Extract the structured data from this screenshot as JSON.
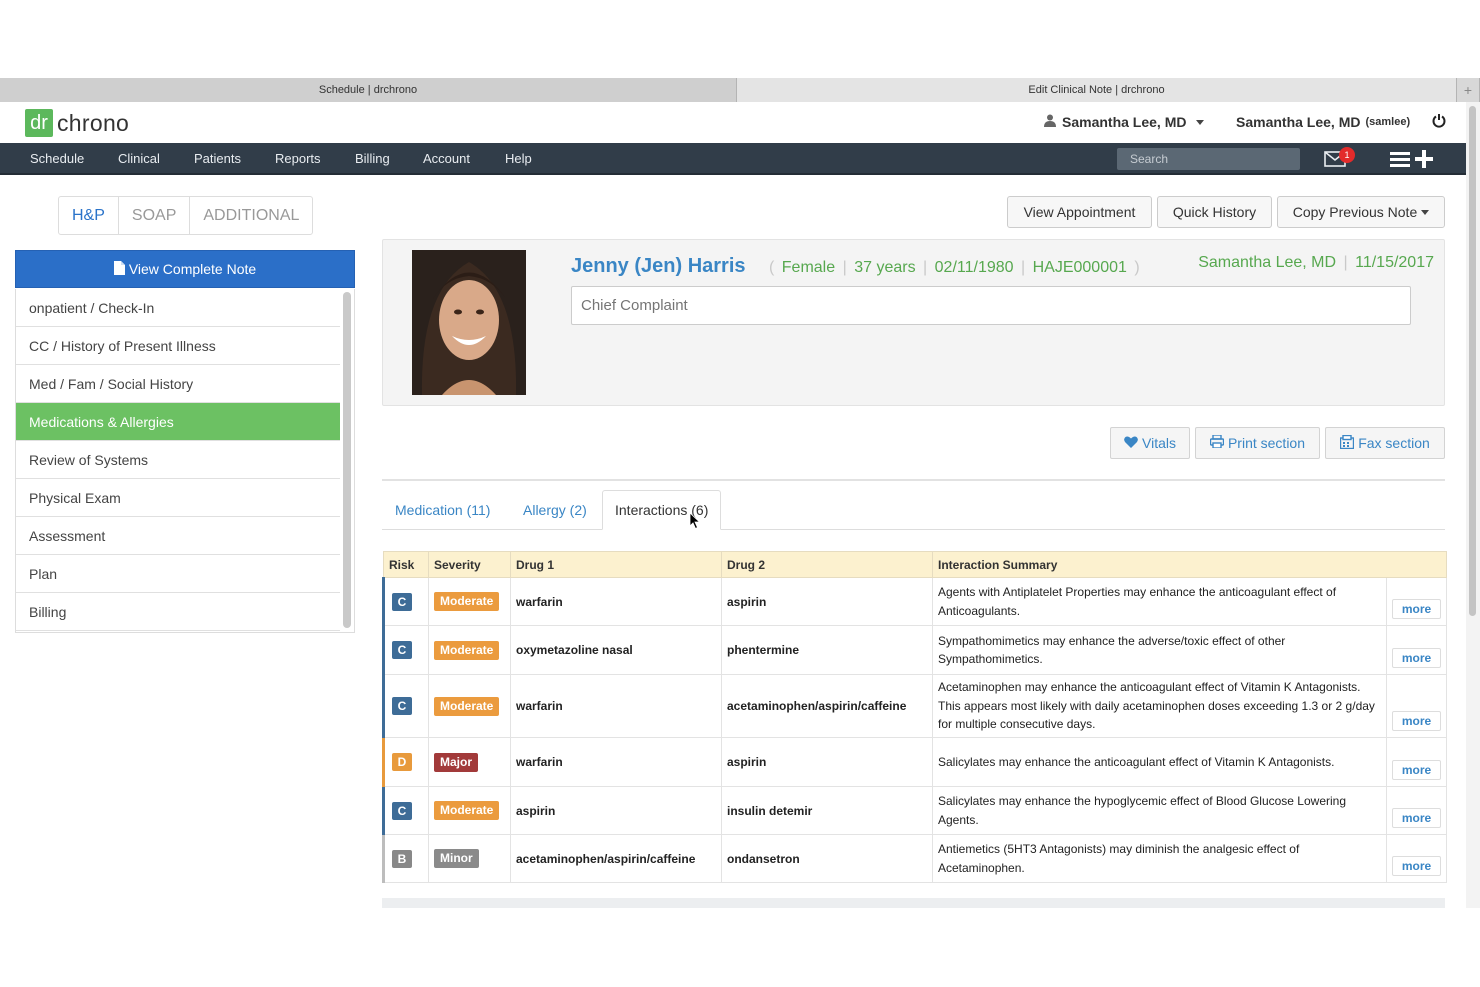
{
  "browser_tabs": [
    {
      "label": "Schedule | drchrono"
    },
    {
      "label": "Edit Clinical Note | drchrono"
    }
  ],
  "new_tab_label": "+",
  "logo": {
    "dr": "dr",
    "chrono": "chrono",
    "brand_color": "#5cb85c"
  },
  "user_menu": {
    "label": "Samantha Lee, MD"
  },
  "user_right": {
    "name": "Samantha Lee, MD",
    "username": "(samlee)"
  },
  "nav": {
    "items": [
      "Schedule",
      "Clinical",
      "Patients",
      "Reports",
      "Billing",
      "Account",
      "Help"
    ],
    "search_placeholder": "Search",
    "mail_badge": "1"
  },
  "note_tabs": [
    "H&P",
    "SOAP",
    "ADDITIONAL"
  ],
  "view_complete_note": "View Complete Note",
  "sections": [
    "onpatient / Check-In",
    "CC / History of Present Illness",
    "Med / Fam / Social History",
    "Medications & Allergies",
    "Review of Systems",
    "Physical Exam",
    "Assessment",
    "Plan",
    "Billing"
  ],
  "active_section": "Medications & Allergies",
  "top_buttons": {
    "view_appointment": "View Appointment",
    "quick_history": "Quick History",
    "copy_previous_note": "Copy Previous Note"
  },
  "patient": {
    "name": "Jenny (Jen) Harris",
    "open_paren": "(",
    "sex": "Female",
    "age": "37 years",
    "dob": "02/11/1980",
    "chart_id": "HAJE000001",
    "close_paren": ")",
    "sep": "|",
    "provider": "Samantha Lee, MD",
    "date": "11/15/2017",
    "chief_complaint_placeholder": "Chief Complaint"
  },
  "section_buttons": {
    "vitals": "Vitals",
    "print": "Print section",
    "fax": "Fax section"
  },
  "med_tabs": [
    "Medication (11)",
    "Allergy (2)",
    "Interactions (6)"
  ],
  "active_med_tab": "Interactions (6)",
  "table": {
    "headers": [
      "Risk",
      "Severity",
      "Drug 1",
      "Drug 2",
      "Interaction Summary"
    ],
    "more_label": "more",
    "rows": [
      {
        "risk": "C",
        "severity": "Moderate",
        "drug1": "warfarin",
        "drug2": "aspirin",
        "summary": "Agents with Antiplatelet Properties may enhance the anticoagulant effect of Anticoagulants."
      },
      {
        "risk": "C",
        "severity": "Moderate",
        "drug1": "oxymetazoline nasal",
        "drug2": "phentermine",
        "summary": "Sympathomimetics may enhance the adverse/toxic effect of other Sympathomimetics."
      },
      {
        "risk": "C",
        "severity": "Moderate",
        "drug1": "warfarin",
        "drug2": "acetaminophen/aspirin/caffeine",
        "summary": "Acetaminophen may enhance the anticoagulant effect of Vitamin K Antagonists. This appears most likely with daily acetaminophen doses exceeding 1.3 or 2 g/day for multiple consecutive days."
      },
      {
        "risk": "D",
        "severity": "Major",
        "drug1": "warfarin",
        "drug2": "aspirin",
        "summary": "Salicylates may enhance the anticoagulant effect of Vitamin K Antagonists."
      },
      {
        "risk": "C",
        "severity": "Moderate",
        "drug1": "aspirin",
        "drug2": "insulin detemir",
        "summary": "Salicylates may enhance the hypoglycemic effect of Blood Glucose Lowering Agents."
      },
      {
        "risk": "B",
        "severity": "Minor",
        "drug1": "acetaminophen/aspirin/caffeine",
        "drug2": "ondansetron",
        "summary": "Antiemetics (5HT3 Antagonists) may diminish the analgesic effect of Acetaminophen."
      }
    ]
  },
  "colors": {
    "nav_bg": "#313d49",
    "primary_blue": "#2b6fc8",
    "active_green": "#6cc163",
    "info_green": "#57a84f",
    "table_header": "#fcf1cf"
  }
}
